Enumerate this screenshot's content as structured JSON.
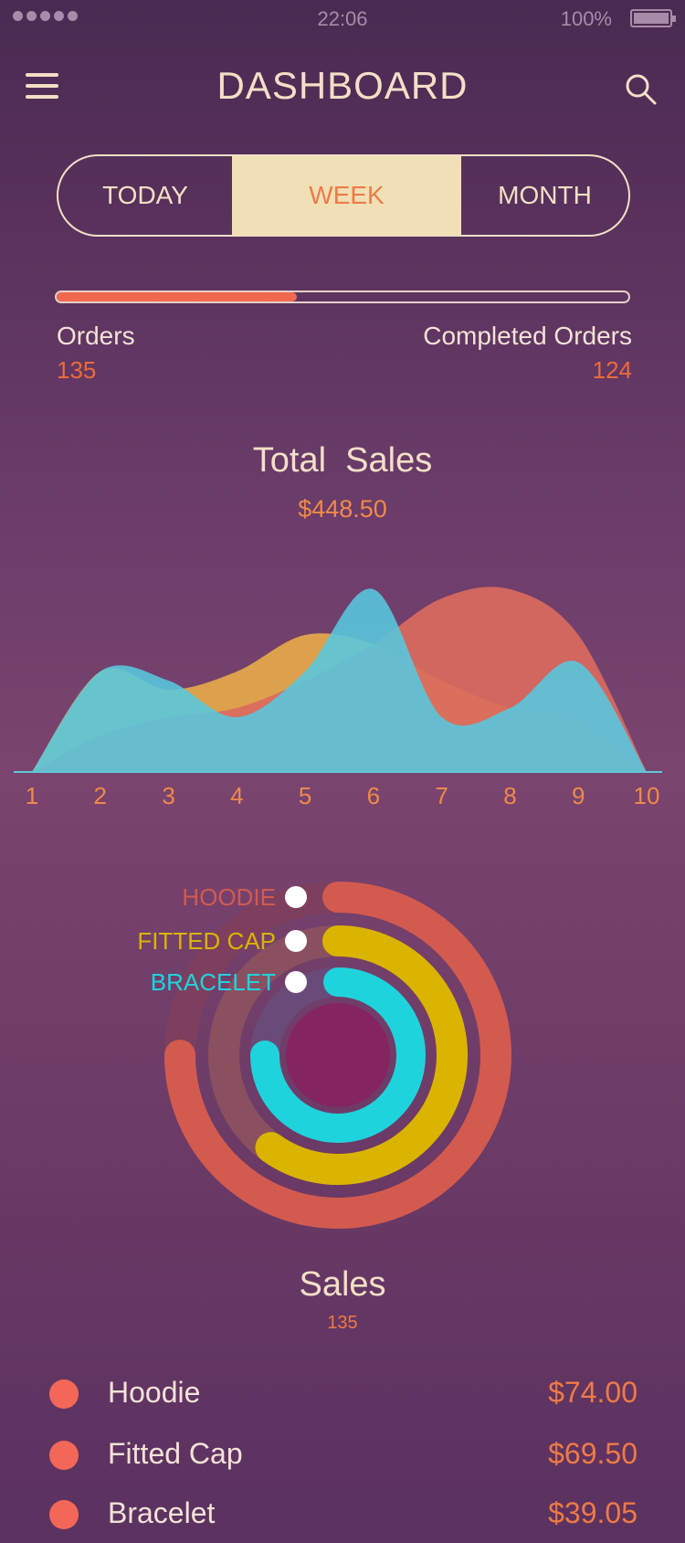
{
  "status_bar": {
    "time": "22:06",
    "battery_percent": "100%"
  },
  "header": {
    "title": "DASHBOARD",
    "menu_icon": "hamburger-menu-icon",
    "search_icon": "search-icon"
  },
  "period_tabs": {
    "items": [
      "TODAY",
      "WEEK",
      "MONTH"
    ],
    "selected": "WEEK"
  },
  "orders": {
    "label": "Orders",
    "value": "135",
    "completed_label": "Completed Orders",
    "completed_value": "124",
    "progress_fraction": 0.42
  },
  "total_sales": {
    "title": "Total  Sales",
    "value": "$448.50"
  },
  "chart_data": [
    {
      "type": "area",
      "x": [
        1,
        2,
        3,
        4,
        5,
        6,
        7,
        8,
        9,
        10
      ],
      "series": [
        {
          "color": "#e6a84a",
          "values": [
            0,
            0.55,
            0.45,
            0.55,
            0.75,
            0.7,
            0.5,
            0.35,
            0.3,
            0
          ]
        },
        {
          "color": "#d96a5e",
          "values": [
            0,
            0.2,
            0.3,
            0.35,
            0.5,
            0.7,
            0.95,
            1.0,
            0.75,
            0
          ]
        },
        {
          "color": "#56c8df",
          "values": [
            0,
            0.55,
            0.5,
            0.3,
            0.55,
            1.0,
            0.3,
            0.35,
            0.6,
            0
          ]
        }
      ]
    },
    {
      "type": "pie",
      "categories": [
        "HOODIE",
        "FITTED CAP",
        "BRACELET"
      ],
      "values": [
        0.75,
        0.6,
        0.75
      ],
      "colors": [
        "#d35a4f",
        "#dbb400",
        "#1fd3dd"
      ]
    }
  ],
  "chart_labels": {
    "x_ticks": [
      "1",
      "2",
      "3",
      "4",
      "5",
      "6",
      "7",
      "8",
      "9",
      "10"
    ]
  },
  "ring_labels": [
    "HOODIE",
    "FITTED CAP",
    "BRACELET"
  ],
  "sales": {
    "title": "Sales",
    "count": "135"
  },
  "sales_list": [
    {
      "name": "Hoodie",
      "price": "$74.00"
    },
    {
      "name": "Fitted Cap",
      "price": "$69.50"
    },
    {
      "name": "Bracelet",
      "price": "$39.05"
    }
  ]
}
